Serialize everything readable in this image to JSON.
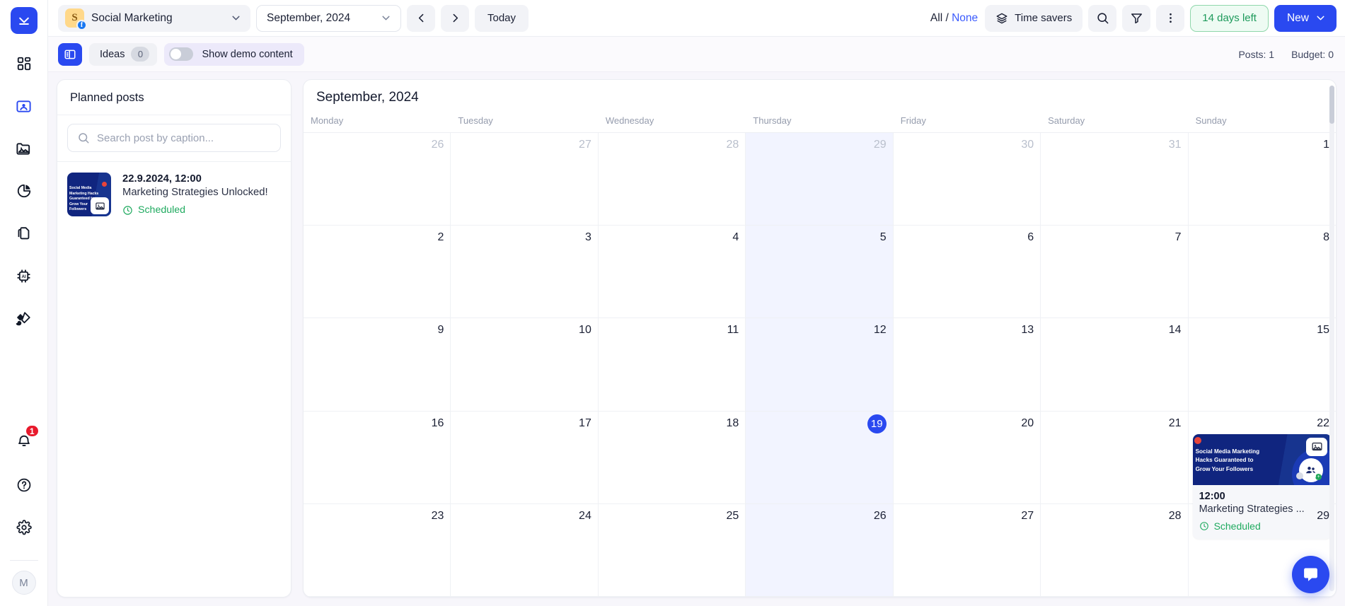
{
  "rail": {
    "logo_icon": "download-logo-icon",
    "items": [
      {
        "name": "dashboard",
        "icon": "grid-icon",
        "active": false
      },
      {
        "name": "profiles",
        "icon": "user-card-icon",
        "active": true
      },
      {
        "name": "media",
        "icon": "image-folder-icon",
        "active": false
      },
      {
        "name": "analytics",
        "icon": "pie-chart-icon",
        "active": false
      },
      {
        "name": "pages",
        "icon": "copy-pages-icon",
        "active": false
      },
      {
        "name": "ai-tools",
        "icon": "ai-chip-icon",
        "active": false
      },
      {
        "name": "design",
        "icon": "brush-pen-icon",
        "active": false
      }
    ],
    "notifications_count": "1",
    "help_icon": "question-circle-icon",
    "settings_icon": "gear-icon",
    "avatar_initial": "M"
  },
  "topbar": {
    "profile": {
      "name": "Social Marketing",
      "avatar_letter": "S",
      "network_letter": "f"
    },
    "date": {
      "value": "September, 2024"
    },
    "prev_label": "previous-month",
    "next_label": "next-month",
    "today_label": "Today",
    "select_all_label": "All",
    "separator": "/",
    "select_none_label": "None",
    "time_savers_label": "Time savers",
    "search_icon": "search-icon",
    "filter_icon": "filter-icon",
    "more_icon": "more-vertical-icon",
    "trial_label": "14 days left",
    "new_label": "New"
  },
  "subbar": {
    "panel_toggle_icon": "side-panel-icon",
    "ideas_label": "Ideas",
    "ideas_count": "0",
    "demo_label": "Show demo content",
    "demo_on": false,
    "posts_counter": "Posts: 1",
    "budget_counter": "Budget: 0"
  },
  "posts_panel": {
    "title": "Planned posts",
    "search_placeholder": "Search post by caption...",
    "search_value": "",
    "items": [
      {
        "date": "22.9.2024, 12:00",
        "caption": "Marketing Strategies Unlocked!",
        "status": "Scheduled",
        "thumb_text": "Social Media Marketing Hacks Guaranteed to Grow Your Followers"
      }
    ]
  },
  "calendar": {
    "title": "September, 2024",
    "weekdays": [
      "Monday",
      "Tuesday",
      "Wednesday",
      "Thursday",
      "Friday",
      "Saturday",
      "Sunday"
    ],
    "today": "19",
    "today_column_index": 3,
    "weeks": [
      [
        {
          "n": "26",
          "out": true
        },
        {
          "n": "27",
          "out": true
        },
        {
          "n": "28",
          "out": true
        },
        {
          "n": "29",
          "out": true
        },
        {
          "n": "30",
          "out": true
        },
        {
          "n": "31",
          "out": true
        },
        {
          "n": "1",
          "out": false
        }
      ],
      [
        {
          "n": "2"
        },
        {
          "n": "3"
        },
        {
          "n": "4"
        },
        {
          "n": "5"
        },
        {
          "n": "6"
        },
        {
          "n": "7"
        },
        {
          "n": "8"
        }
      ],
      [
        {
          "n": "9"
        },
        {
          "n": "10"
        },
        {
          "n": "11"
        },
        {
          "n": "12"
        },
        {
          "n": "13"
        },
        {
          "n": "14"
        },
        {
          "n": "15"
        }
      ],
      [
        {
          "n": "16"
        },
        {
          "n": "17"
        },
        {
          "n": "18"
        },
        {
          "n": "19",
          "today": true
        },
        {
          "n": "20"
        },
        {
          "n": "21"
        },
        {
          "n": "22",
          "event": true
        }
      ],
      [
        {
          "n": "23"
        },
        {
          "n": "24"
        },
        {
          "n": "25"
        },
        {
          "n": "26"
        },
        {
          "n": "27"
        },
        {
          "n": "28"
        },
        {
          "n": "29"
        }
      ]
    ],
    "event": {
      "time": "12:00",
      "caption": "Marketing Strategies ...",
      "status": "Scheduled",
      "thumb_text": "Social Media Marketing Hacks Guaranteed to Grow Your Followers"
    }
  },
  "colors": {
    "brand_blue": "#2a49f0",
    "success_green": "#1faa5f",
    "badge_red": "#e8192c",
    "today_bg": "#f2f4ff"
  },
  "intercom": {
    "icon": "chat-bubble-icon"
  }
}
